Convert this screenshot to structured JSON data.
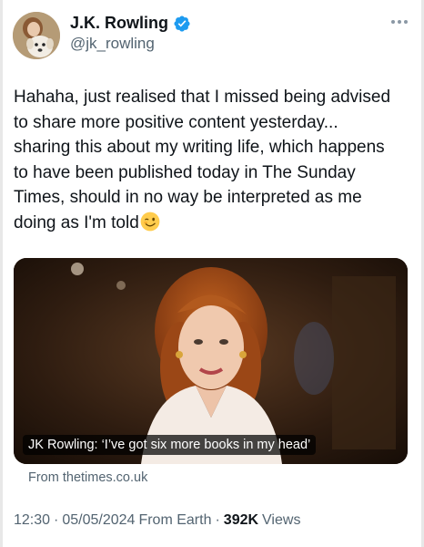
{
  "author": {
    "name": "J.K. Rowling",
    "handle": "@jk_rowling",
    "verified_icon": "verified-badge-icon",
    "verified_color": "#1d9bf0"
  },
  "tweet": {
    "text": "Hahaha, just realised that I missed being advised\nto share more positive content yesterday...\nsharing this about my writing life, which happens\nto have been published today in The Sunday\nTimes, should in no way be interpreted as me\ndoing as I'm told",
    "emoji": "winking-face"
  },
  "card": {
    "caption": "JK Rowling: ‘I’ve got six more books in my head’",
    "source": "From thetimes.co.uk"
  },
  "meta": {
    "time": "12:30",
    "date": "05/05/2024",
    "location": "From Earth",
    "views_count": "392K",
    "views_label": "Views",
    "separator": "·"
  }
}
